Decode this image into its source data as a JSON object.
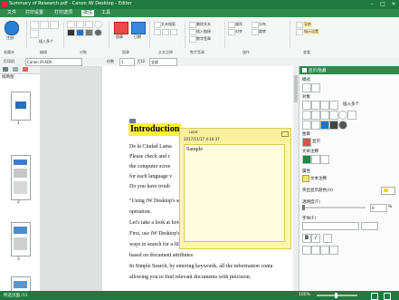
{
  "window": {
    "title": "Summary of Research.pdf - Canon iW Desktop - Editor"
  },
  "menu": {
    "items": [
      "文件",
      "打印设置",
      "打印选项",
      "批注",
      "工具"
    ],
    "active_index": 3
  },
  "ribbon": {
    "groups": [
      {
        "label": "收藏夹"
      },
      {
        "label": "编辑"
      },
      {
        "label": "对象"
      },
      {
        "label": "图章"
      },
      {
        "label": "文本注释"
      },
      {
        "label": "超链接"
      },
      {
        "label": "数字签章"
      },
      {
        "label": "操作"
      },
      {
        "label": "查看"
      }
    ],
    "buttons": {
      "favorites": "注册",
      "insert_multi": "插入多个",
      "stamp": "图章",
      "date": "日期",
      "text_search": "文本搜索",
      "delete_text": "删除文本",
      "link_insert": "插入链接",
      "digital_sig": "数字签章",
      "order": "顺序",
      "align": "对齐",
      "distribute": "分布",
      "rotate": "旋转",
      "navigate": "导航",
      "mark_settings": "指示设置"
    }
  },
  "toolbar2": {
    "printer_label": "打印机",
    "printer_value": "Canon iR-ADV",
    "copies_label": "份数",
    "copies_value": "1",
    "range_label": "打印",
    "range_value": "全部"
  },
  "left_panel": {
    "title": "缩略图",
    "pages": [
      "1",
      "2",
      "3"
    ]
  },
  "document": {
    "heading": "Introduction",
    "lines": [
      "De la Ciudad Lama",
      "Please check and r",
      "the computer scree",
      "for each language v",
      "Do you have troub",
      "\"Using iW Desktop's search function, you can quickly find the",
      "operation.",
      "Let's take a look at how to make use of the search function and ex",
      "First, use iW Desktop's search function to find the documents that",
      "ways to search for a file. You can do a Simple Search based on t",
      "based on document attributes",
      "In Simple Search, by entering keywords, all the information conta",
      "allowing you to find relevant documents with precision."
    ]
  },
  "note": {
    "author": "user",
    "timestamp": "2017/11/17 4:16:37",
    "text": "Sample"
  },
  "right_panel": {
    "header": "显示/隐藏",
    "sections": {
      "mode": "模式",
      "objects": "对象",
      "insert_multi": "插入多个",
      "stamp": "图章",
      "stamp_btn": "显示",
      "text_annot": "文本注释",
      "properties": "属性",
      "text_note": "文本注释",
      "font_color_label": "突出显示颜色(H)",
      "opacity_label": "透明度(T)",
      "opacity_value": "0",
      "opacity_unit": "%",
      "font_label": "字体(F)"
    }
  },
  "status_bar": {
    "page_info": "所选页面 /11",
    "zoom": "100%"
  },
  "colors": {
    "brand_green": "#1e7a3e",
    "note_yellow": "#fdf6b0",
    "highlight_yellow": "#ffef3a"
  }
}
